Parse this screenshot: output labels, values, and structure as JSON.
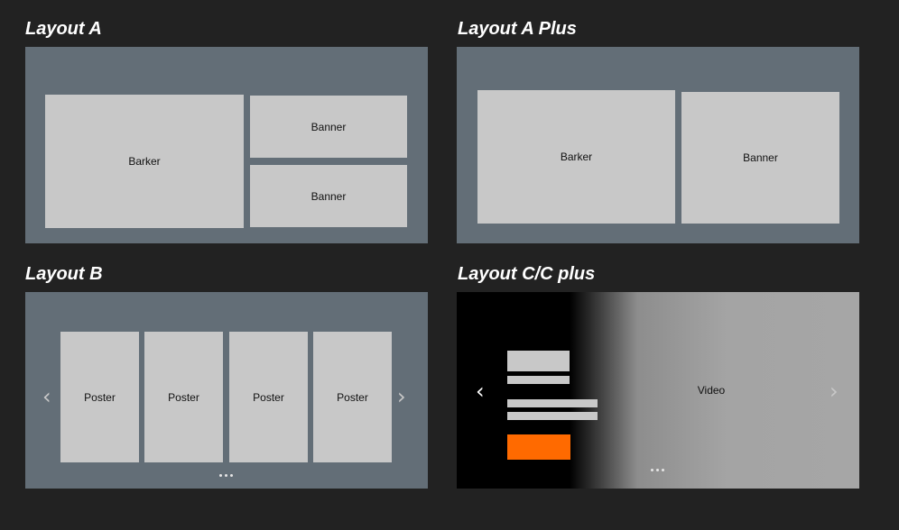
{
  "layout_a": {
    "title": "Layout A",
    "barker": "Barker",
    "banner_top": "Banner",
    "banner_bottom": "Banner"
  },
  "layout_a_plus": {
    "title": "Layout A Plus",
    "barker": "Barker",
    "banner": "Banner"
  },
  "layout_b": {
    "title": "Layout B",
    "posters": [
      "Poster",
      "Poster",
      "Poster",
      "Poster"
    ],
    "prev_icon": "chevron-left-icon",
    "next_icon": "chevron-right-icon"
  },
  "layout_c": {
    "title": "Layout C/C plus",
    "video": "Video",
    "cta_color": "#ff6a00",
    "prev_icon": "chevron-left-icon",
    "next_icon": "chevron-right-icon"
  },
  "colors": {
    "background": "#222222",
    "panel": "#636e77",
    "tile": "#c8c8c8",
    "accent": "#ff6a00"
  }
}
